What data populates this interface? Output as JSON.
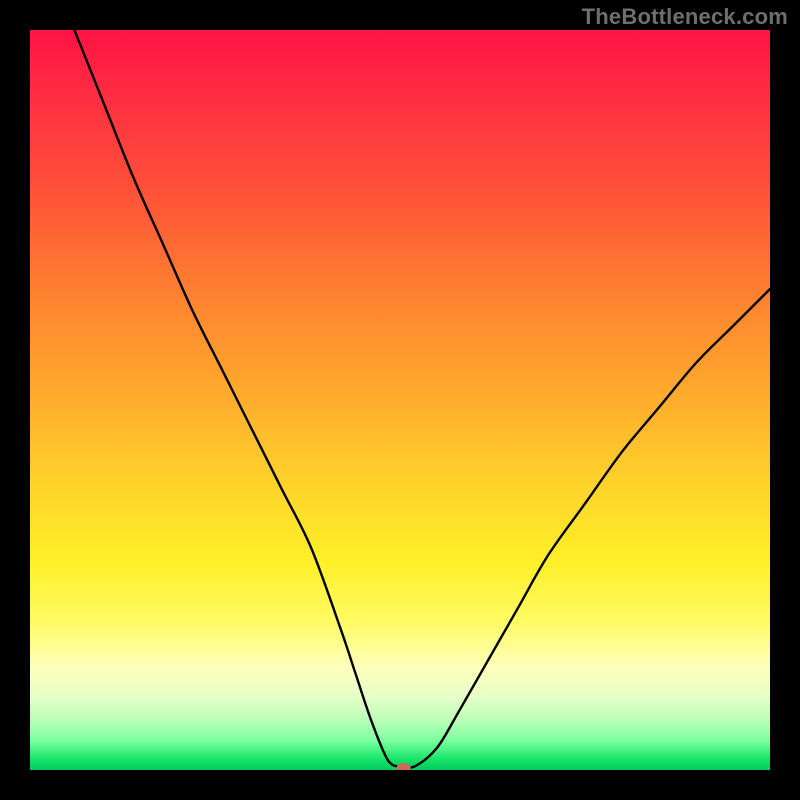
{
  "watermark": "TheBottleneck.com",
  "chart_data": {
    "type": "line",
    "title": "",
    "xlabel": "",
    "ylabel": "",
    "xlim": [
      0,
      100
    ],
    "ylim": [
      0,
      100
    ],
    "grid": false,
    "legend": false,
    "background_gradient": {
      "orientation": "vertical",
      "stops": [
        {
          "pos": 0.0,
          "color": "#ff1345"
        },
        {
          "pos": 0.22,
          "color": "#ff5238"
        },
        {
          "pos": 0.5,
          "color": "#ffad2d"
        },
        {
          "pos": 0.72,
          "color": "#fff028"
        },
        {
          "pos": 0.86,
          "color": "#fdffb9"
        },
        {
          "pos": 0.93,
          "color": "#bfffba"
        },
        {
          "pos": 1.0,
          "color": "#00c85c"
        }
      ]
    },
    "series": [
      {
        "name": "bottleneck-curve",
        "color": "#000000",
        "x": [
          6,
          10,
          14,
          18,
          22,
          26,
          30,
          34,
          38,
          42,
          44,
          46,
          48,
          49,
          50,
          52,
          55,
          58,
          62,
          66,
          70,
          75,
          80,
          85,
          90,
          95,
          100
        ],
        "y": [
          100,
          90,
          80,
          71,
          62,
          54,
          46,
          38,
          30,
          19,
          13,
          7,
          2,
          0.7,
          0.5,
          0.5,
          3,
          8,
          15,
          22,
          29,
          36,
          43,
          49,
          55,
          60,
          65
        ]
      }
    ],
    "marker": {
      "x": 50.5,
      "y": 0.3,
      "color": "#c86b58",
      "shape": "rounded-rect"
    }
  }
}
